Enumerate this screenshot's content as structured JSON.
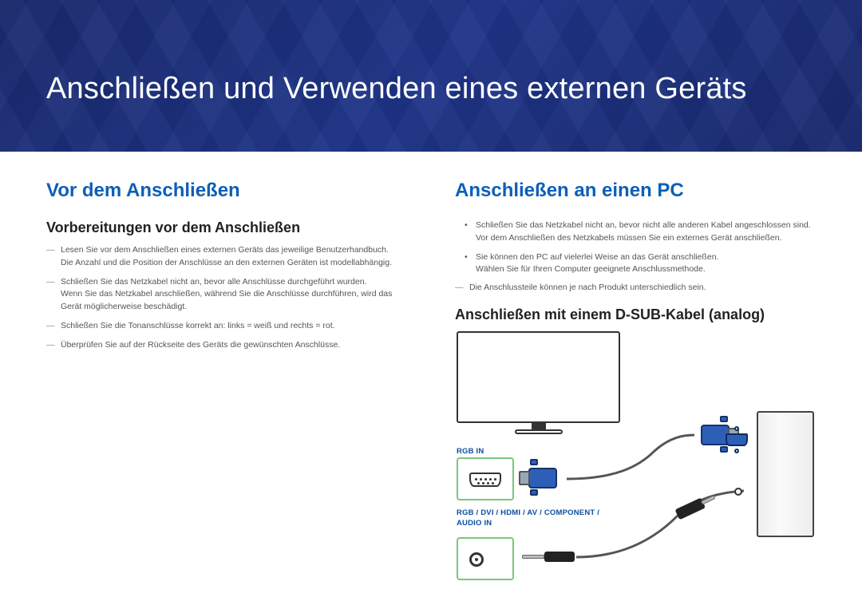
{
  "page_title": "Anschließen und Verwenden eines externen Geräts",
  "left": {
    "heading": "Vor dem Anschließen",
    "subheading": "Vorbereitungen vor dem Anschließen",
    "items": [
      {
        "main": "Lesen Sie vor dem Anschließen eines externen Geräts das jeweilige Benutzerhandbuch.",
        "sub": "Die Anzahl und die Position der Anschlüsse an den externen Geräten ist modellabhängig."
      },
      {
        "main": "Schließen Sie das Netzkabel nicht an, bevor alle Anschlüsse durchgeführt wurden.",
        "sub": "Wenn Sie das Netzkabel anschließen, während Sie die Anschlüsse durchführen, wird das Gerät möglicherweise beschädigt."
      },
      {
        "main": "Schließen Sie die Tonanschlüsse korrekt an: links = weiß und rechts = rot.",
        "sub": ""
      },
      {
        "main": "Überprüfen Sie auf der Rückseite des Geräts die gewünschten Anschlüsse.",
        "sub": ""
      }
    ]
  },
  "right": {
    "heading": "Anschließen an einen PC",
    "bullets": [
      {
        "main": "Schließen Sie das Netzkabel nicht an, bevor nicht alle anderen Kabel angeschlossen sind.",
        "sub": "Vor dem Anschließen des Netzkabels müssen Sie ein externes Gerät anschließen."
      },
      {
        "main": "Sie können den PC auf vielerlei Weise an das Gerät anschließen.",
        "sub": "Wählen Sie für Ihren Computer geeignete Anschlussmethode."
      }
    ],
    "note": "Die Anschlussteile können je nach Produkt unterschiedlich sein.",
    "subheading": "Anschließen mit einem D-SUB-Kabel (analog)",
    "labels": {
      "rgb": "RGB IN",
      "audio": "RGB / DVI / HDMI / AV / COMPONENT / AUDIO IN"
    }
  }
}
